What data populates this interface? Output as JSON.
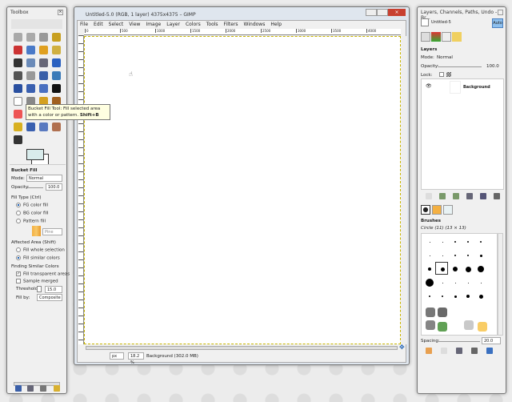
{
  "toolbox": {
    "title": "Toolbox",
    "tooltip": {
      "text": "Bucket Fill Tool: Fill selected area with a color or pattern.",
      "shortcut": "Shift+B"
    },
    "options": {
      "title": "Bucket Fill",
      "mode_label": "Mode:",
      "mode_value": "Normal",
      "opacity_label": "Opacity:",
      "opacity_value": "100.0",
      "fill_type_label": "Fill Type  (Ctrl)",
      "fill_types": [
        "FG color fill",
        "BG color fill",
        "Pattern fill"
      ],
      "selected_fill_type": 0,
      "pattern_name": "Pine",
      "affected_area_label": "Affected Area  (Shift)",
      "affected_areas": [
        "Fill whole selection",
        "Fill similar colors"
      ],
      "selected_area": 1,
      "finding_label": "Finding Similar Colors",
      "fill_transparent": "Fill transparent areas",
      "fill_transparent_checked": true,
      "sample_merged": "Sample merged",
      "sample_merged_checked": false,
      "threshold_label": "Threshold:",
      "threshold_value": "15.0",
      "fill_by_label": "Fill by:",
      "fill_by_value": "Composite"
    },
    "fg_color": "#d9ecec",
    "bg_color": "#ffffff"
  },
  "image_window": {
    "title": "Untitled-5.0 (RGB, 1 layer) 4375x4375 – GIMP",
    "menu": [
      "File",
      "Edit",
      "Select",
      "View",
      "Image",
      "Layer",
      "Colors",
      "Tools",
      "Filters",
      "Windows",
      "Help"
    ],
    "ruler_ticks": [
      "0",
      "500",
      "1000",
      "1500",
      "2000",
      "2500",
      "3000",
      "3500",
      "4000"
    ],
    "unit": "px",
    "zoom": "18.2 %",
    "status": "Background (302.0 MB)"
  },
  "dock": {
    "title": "Layers, Channels, Paths, Undo - Br...",
    "image_name": "Untitled-5",
    "auto_label": "Auto",
    "layers": {
      "title": "Layers",
      "mode_label": "Mode:",
      "mode_value": "Normal",
      "opacity_label": "Opacity:",
      "opacity_value": "100.0",
      "lock_label": "Lock:",
      "items": [
        {
          "name": "Background"
        }
      ]
    },
    "brushes": {
      "title": "Brushes",
      "current": "Circle (11) (13 × 13)",
      "spacing_label": "Spacing:",
      "spacing_value": "20.0"
    }
  }
}
